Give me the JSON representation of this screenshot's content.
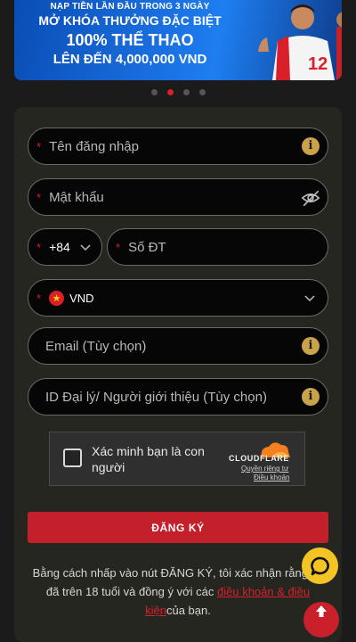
{
  "banner": {
    "line1": "NẠP TIỀN LẦN ĐẦU TRONG 3 NGÀY",
    "line2": "MỞ KHÓA THƯỞNG ĐẶC BIỆT",
    "line3": "100% THỂ THAO",
    "line4": "LÊN ĐẾN 4,000,000 VND",
    "jersey_number": "12"
  },
  "carousel": {
    "count": 4,
    "active_index": 1
  },
  "form": {
    "username_placeholder": "Tên đăng nhập",
    "password_placeholder": "Mật khẩu",
    "country_code": "+84",
    "phone_placeholder": "Số ĐT",
    "currency": "VND",
    "email_placeholder": "Email (Tùy chọn)",
    "referral_placeholder": "ID Đại lý/ Người giới thiệu (Tùy chọn)",
    "required_mark": "*",
    "info_glyph": "i"
  },
  "captcha": {
    "label": "Xác minh bạn là con người",
    "brand": "CLOUDFLARE",
    "privacy": "Quyền riêng tư",
    "terms": "Điều khoản"
  },
  "register_button": "ĐĂNG KÝ",
  "terms_text": {
    "before": "Bằng cách nhấp vào nút ĐĂNG KÝ, tôi xác nhận rằng tôi đã trên 18 tuổi và đồng ý với các ",
    "link": "điều khoản & điều kiện",
    "after": "của bạn."
  },
  "icons": {
    "info": "info-icon",
    "eye_off": "eye-off-icon",
    "chevron": "chevron-down-icon",
    "flag": "vietnam-flag-icon",
    "chat": "chat-icon",
    "scroll_top": "arrow-up-icon"
  },
  "colors": {
    "accent": "#c4202b",
    "info_icon": "#c9a24a",
    "chat_button": "#f4c425",
    "card": "#262620",
    "field_bg": "#060606"
  }
}
